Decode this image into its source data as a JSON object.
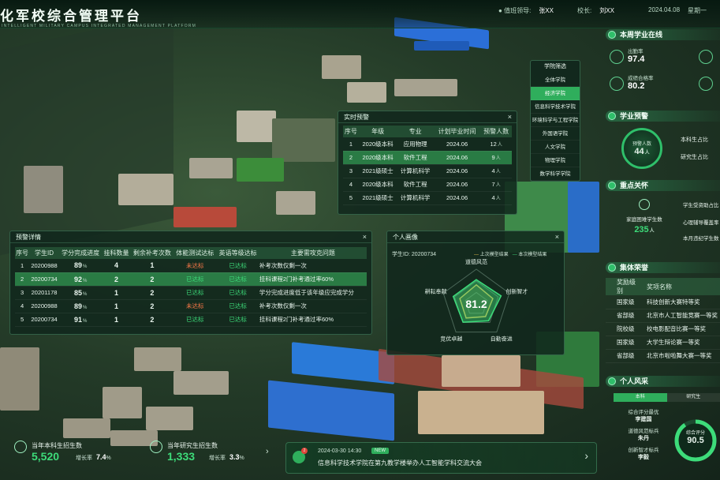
{
  "header": {
    "title": "化军校综合管理平台",
    "subtitle": "INTELLIGENT MILITARY CAMPUS INTEGRATED MANAGEMENT PLATFORM",
    "leader_label": "值班领导:",
    "leader_value": "张XX",
    "principal_label": "校长:",
    "principal_value": "刘XX",
    "date": "2024.04.08",
    "weekday": "星期一"
  },
  "filter": {
    "title": "学院筛选",
    "items": [
      "全体学院",
      "经济学院",
      "信息科学技术学院",
      "环境科学与工程学院",
      "外国语学院",
      "人文学院",
      "物理学院",
      "数学科学学院"
    ],
    "active_index": 1
  },
  "realtime": {
    "title": "实时预警",
    "close": "×",
    "headers": [
      "序号",
      "年级",
      "专业",
      "计划毕业时间",
      "预警人数"
    ],
    "rows": [
      {
        "no": "1",
        "grade": "2020级本科",
        "major": "应用物理",
        "date": "2024.06",
        "count": "12",
        "unit": "人"
      },
      {
        "no": "2",
        "grade": "2020级本科",
        "major": "软件工程",
        "date": "2024.06",
        "count": "9",
        "unit": "人"
      },
      {
        "no": "3",
        "grade": "2021级硕士",
        "major": "计算机科学",
        "date": "2024.06",
        "count": "4",
        "unit": "人"
      },
      {
        "no": "4",
        "grade": "2020级本科",
        "major": "软件工程",
        "date": "2024.06",
        "count": "7",
        "unit": "人"
      },
      {
        "no": "5",
        "grade": "2021级硕士",
        "major": "计算机科学",
        "date": "2024.06",
        "count": "4",
        "unit": "人"
      }
    ],
    "highlight_index": 1
  },
  "warning_detail": {
    "title": "预警详情",
    "close": "×",
    "headers": [
      "序号",
      "学生ID",
      "学分完成进度",
      "挂科数量",
      "剩余补考次数",
      "体能测试达标",
      "英语等级达标",
      "主要需攻克问题"
    ],
    "rows": [
      {
        "no": "1",
        "id": "20200988",
        "progress": "89",
        "fail": "4",
        "retake": "1",
        "pe": "未达标",
        "pe_ok": false,
        "en": "已达标",
        "en_ok": true,
        "issue": "补考次数仅剩一次"
      },
      {
        "no": "2",
        "id": "20200734",
        "progress": "92",
        "fail": "2",
        "retake": "2",
        "pe": "已达标",
        "pe_ok": true,
        "en": "已达标",
        "en_ok": true,
        "issue": "挂科课程2门补考通过率60%"
      },
      {
        "no": "3",
        "id": "20201178",
        "progress": "85",
        "fail": "1",
        "retake": "2",
        "pe": "已达标",
        "pe_ok": true,
        "en": "已达标",
        "en_ok": true,
        "issue": "学分完成进度低于该年级应完成学分"
      },
      {
        "no": "4",
        "id": "20200988",
        "progress": "89",
        "fail": "1",
        "retake": "2",
        "pe": "未达标",
        "pe_ok": false,
        "en": "已达标",
        "en_ok": true,
        "issue": "补考次数仅剩一次"
      },
      {
        "no": "5",
        "id": "20200734",
        "progress": "91",
        "fail": "1",
        "retake": "2",
        "pe": "已达标",
        "pe_ok": true,
        "en": "已达标",
        "en_ok": true,
        "issue": "挂科课程2门补考通过率60%"
      }
    ],
    "percent_unit": "%",
    "highlight_index": 1
  },
  "portrait": {
    "title": "个人画像",
    "close": "×",
    "student_label": "学生ID:",
    "student_id": "20200734",
    "legend_prev": "上次模型结果",
    "legend_curr": "本次模型结果",
    "score": "81.2",
    "dims": [
      "道德风范",
      "创新智才",
      "自勤奋进",
      "竞优卓越",
      "耕耘奉献"
    ],
    "prev_values": [
      0.55,
      0.5,
      0.45,
      0.5,
      0.5
    ],
    "curr_values": [
      0.7,
      0.75,
      0.6,
      0.65,
      0.7
    ]
  },
  "weekly": {
    "title": "本周学业在线",
    "items": [
      {
        "label": "出勤率",
        "value": "97.4"
      },
      {
        "label": "成绩合格率",
        "value": "80.2"
      }
    ]
  },
  "academic_warning": {
    "title": "学业预警",
    "gauge_label": "预警人数",
    "gauge_value": "44",
    "gauge_unit": "人",
    "items": [
      "本科生占比",
      "研究生占比"
    ]
  },
  "focus": {
    "title": "重点关怀",
    "center_label": "家庭困难学生数",
    "center_value": "235",
    "center_unit": "人",
    "items": [
      "学生受资助占比",
      "心理辅导覆盖率",
      "本月违纪学生数"
    ]
  },
  "honor": {
    "title": "集体荣誉",
    "headers": [
      "奖励级别",
      "奖项名称"
    ],
    "rows": [
      {
        "level": "国家级",
        "name": "科技创新大赛特等奖"
      },
      {
        "level": "省部级",
        "name": "北京市人工智能竞赛一等奖"
      },
      {
        "level": "院校级",
        "name": "校电影配音比赛一等奖"
      },
      {
        "level": "国家级",
        "name": "大学生辩论赛一等奖"
      },
      {
        "level": "省部级",
        "name": "北京市啦啦舞大赛一等奖"
      }
    ]
  },
  "personal": {
    "title": "个人风采",
    "tabs": [
      "本科",
      "研究生"
    ],
    "active_tab": 0,
    "awards": [
      {
        "label": "综合评分最优",
        "name": "李建国"
      },
      {
        "label": "道德风范标兵",
        "name": "朱丹"
      },
      {
        "label": "创新智才标兵",
        "name": "李毅"
      }
    ],
    "score_label": "综合评分",
    "score": "90.5",
    "score_fraction": 0.905
  },
  "bottom": {
    "ug": {
      "label": "当年本科生招生数",
      "value": "5,520",
      "growth_label": "增长率",
      "growth": "7.4",
      "unit": "%"
    },
    "pg": {
      "label": "当年研究生招生数",
      "value": "1,333",
      "growth_label": "增长率",
      "growth": "3.3",
      "unit": "%"
    },
    "news": {
      "time": "2024-03-30  14:30",
      "badge": "NEW",
      "text": "信息科学技术学院在第九教学楼举办人工智能学科交流大会",
      "notify_count": "2"
    }
  },
  "colors": {
    "accent": "#2fbf6a",
    "warn": "#ff7a4a",
    "ok": "#3ddc7a",
    "highlight": "#2fae5c"
  }
}
